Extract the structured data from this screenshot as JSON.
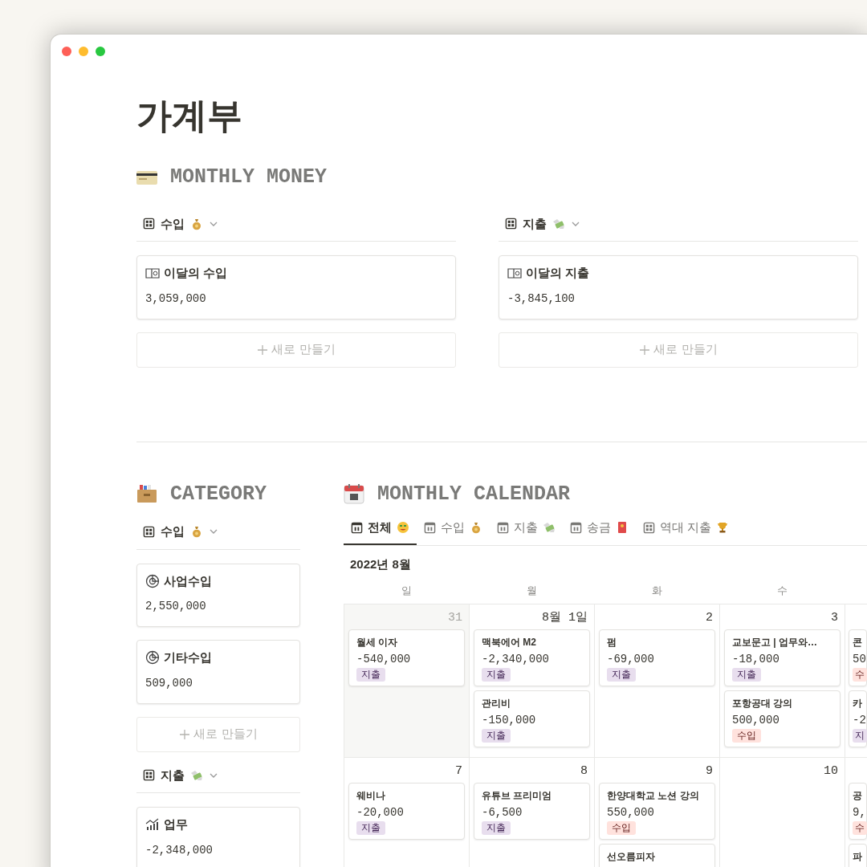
{
  "window": {
    "title": "가계부"
  },
  "monthly_money": {
    "heading": "MONTHLY MONEY",
    "boards": [
      {
        "view": "수입",
        "cards": [
          {
            "title": "이달의 수입",
            "value": "3,059,000"
          }
        ],
        "new_button": "새로 만들기"
      },
      {
        "view": "지출",
        "cards": [
          {
            "title": "이달의 지출",
            "value": "-3,845,100"
          }
        ],
        "new_button": "새로 만들기"
      }
    ]
  },
  "category": {
    "heading": "CATEGORY",
    "groups": [
      {
        "view": "수입",
        "cards": [
          {
            "title": "사업수입",
            "value": "2,550,000"
          },
          {
            "title": "기타수입",
            "value": "509,000"
          }
        ],
        "new_button": "새로 만들기"
      },
      {
        "view": "지출",
        "cards": [
          {
            "title": "업무",
            "value": "-2,348,000"
          }
        ]
      }
    ]
  },
  "calendar": {
    "heading": "MONTHLY CALENDAR",
    "tabs": [
      {
        "label": "전체",
        "selected": true
      },
      {
        "label": "수입",
        "selected": false
      },
      {
        "label": "지출",
        "selected": false
      },
      {
        "label": "송금",
        "selected": false
      },
      {
        "label": "역대 지출",
        "selected": false
      }
    ],
    "month": "2022년 8월",
    "weekdays": [
      "일",
      "월",
      "화",
      "수"
    ],
    "weeks": [
      [
        {
          "day": "31",
          "muted": true,
          "events": [
            {
              "title": "월세 이자",
              "amount": "-540,000",
              "tag": "지출",
              "kind": "expense"
            }
          ]
        },
        {
          "day": "8월 1일",
          "muted": false,
          "events": [
            {
              "title": "맥북에어 M2",
              "amount": "-2,340,000",
              "tag": "지출",
              "kind": "expense"
            },
            {
              "title": "관리비",
              "amount": "-150,000",
              "tag": "지출",
              "kind": "expense"
            }
          ]
        },
        {
          "day": "2",
          "muted": false,
          "events": [
            {
              "title": "펌",
              "amount": "-69,000",
              "tag": "지출",
              "kind": "expense"
            }
          ]
        },
        {
          "day": "3",
          "muted": false,
          "events": [
            {
              "title": "교보문고 | 업무와…",
              "amount": "-18,000",
              "tag": "지출",
              "kind": "expense"
            },
            {
              "title": "포항공대 강의",
              "amount": "500,000",
              "tag": "수입",
              "kind": "income"
            }
          ]
        },
        {
          "events": [
            {
              "title": "콘",
              "amount": "50",
              "tag": "수",
              "kind": "income"
            },
            {
              "title": "카",
              "amount": "-2",
              "tag": "지",
              "kind": "expense"
            }
          ]
        }
      ],
      [
        {
          "day": "7",
          "muted": false,
          "events": [
            {
              "title": "웨비나",
              "amount": "-20,000",
              "tag": "지출",
              "kind": "expense"
            }
          ]
        },
        {
          "day": "8",
          "muted": false,
          "events": [
            {
              "title": "유튜브 프리미엄",
              "amount": "-6,500",
              "tag": "지출",
              "kind": "expense"
            }
          ]
        },
        {
          "day": "9",
          "muted": false,
          "events": [
            {
              "title": "한양대학교 노션 강의",
              "amount": "550,000",
              "tag": "수입",
              "kind": "income"
            },
            {
              "title": "선오름피자"
            }
          ]
        },
        {
          "day": "10",
          "muted": false
        },
        {
          "events": [
            {
              "title": "공",
              "amount": "9,",
              "tag": "수",
              "kind": "income"
            },
            {
              "title": "파"
            }
          ]
        }
      ]
    ]
  }
}
